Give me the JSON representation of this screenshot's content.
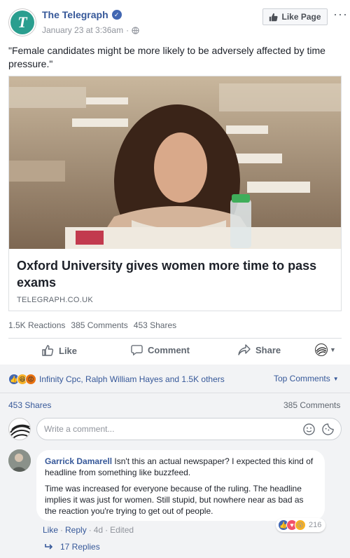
{
  "post": {
    "page_name": "The Telegraph",
    "timestamp": "January 23 at 3:36am",
    "like_page_label": "Like Page",
    "text": "\"Female candidates might be more likely to be adversely affected by time pressure.\""
  },
  "link": {
    "headline": "Oxford University gives women more time to pass exams",
    "domain": "TELEGRAPH.CO.UK"
  },
  "stats": {
    "reactions": "1.5K Reactions",
    "comments": "385 Comments",
    "shares": "453 Shares"
  },
  "actions": {
    "like": "Like",
    "comment": "Comment",
    "share": "Share"
  },
  "reactions_summary": {
    "text": "Infinity Cpc, Ralph William Hayes and 1.5K others",
    "sort_label": "Top Comments"
  },
  "counts": {
    "shares": "453 Shares",
    "comments": "385 Comments"
  },
  "composer": {
    "placeholder": "Write a comment..."
  },
  "comment": {
    "author": "Garrick Damarell",
    "text1": "Isn't this an actual newspaper? I expected this kind of headline from something like buzzfeed.",
    "text2": "Time was increased for everyone because of the ruling. The headline implies it was just for women. Still stupid, but nowhere near as bad as the reaction you're trying to get out of people.",
    "reaction_count": "216",
    "like_label": "Like",
    "reply_label": "Reply",
    "age": "4d",
    "edited_label": "Edited",
    "replies_label": "17 Replies"
  },
  "colors": {
    "link_blue": "#365899",
    "brand_blue": "#4267b2",
    "telegraph_teal": "#2a9e8f",
    "gray_bg": "#f2f3f5"
  }
}
